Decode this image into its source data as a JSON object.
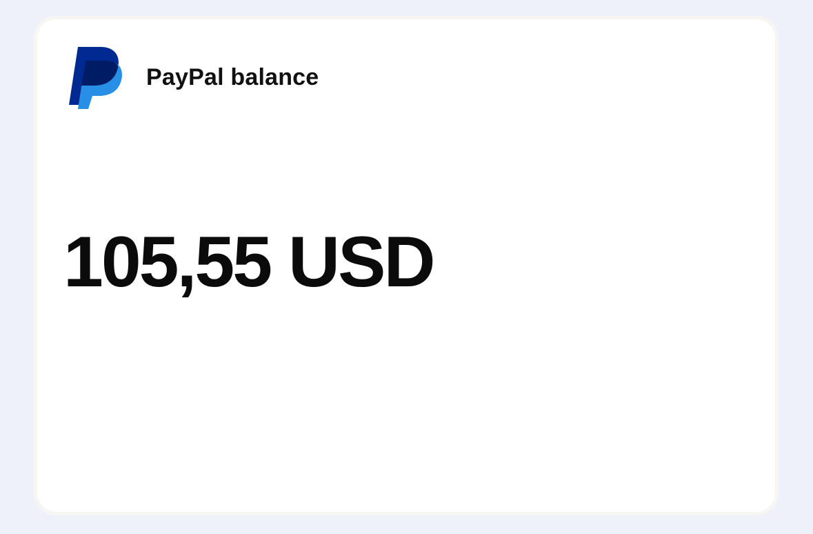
{
  "card": {
    "title": "PayPal balance",
    "balance": "105,55 USD",
    "logo_icon": "paypal-logo-icon"
  },
  "colors": {
    "background": "#eef1f9",
    "card": "#ffffff",
    "text": "#0b0b0b",
    "logo_dark": "#002991",
    "logo_mid": "#001c64",
    "logo_light": "#2790e6"
  }
}
